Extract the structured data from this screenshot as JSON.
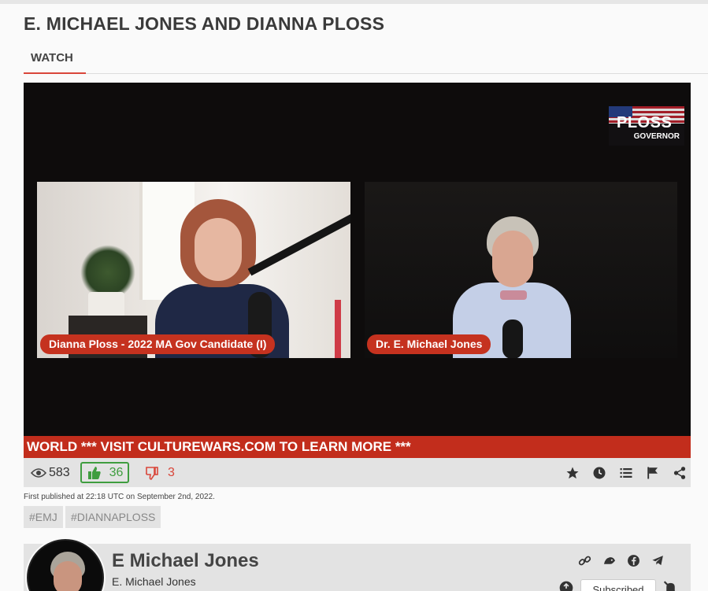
{
  "page": {
    "title": "E. MICHAEL JONES AND DIANNA PLOSS",
    "tabs": [
      {
        "label": "WATCH",
        "active": true
      }
    ]
  },
  "video": {
    "logo_text": "PLOSS",
    "logo_subtext": "GOVERNOR",
    "lower_third_left": "Dianna Ploss - 2022 MA Gov Candidate (I)",
    "lower_third_right": "Dr. E. Michael Jones",
    "ticker_text": "WORLD *** VISIT CULTUREWARS.COM TO LEARN MORE ***"
  },
  "stats": {
    "views": "583",
    "likes": "36",
    "dislikes": "3",
    "actions": [
      "star-icon",
      "clock-icon",
      "list-icon",
      "flag-icon",
      "share-icon"
    ]
  },
  "published": "First published at 22:18 UTC on September 2nd, 2022.",
  "hashtags": [
    "#EMJ",
    "#DIANNAPLOSS"
  ],
  "channel": {
    "name": "E Michael Jones",
    "subtitle": "E. Michael Jones",
    "links": [
      "link-icon",
      "rumble-icon",
      "facebook-icon",
      "telegram-icon"
    ],
    "subscribe_label": "Subscribed"
  },
  "colors": {
    "accent": "#d9463a",
    "like_green": "#3f9d3f",
    "ticker_red": "#c22d1c"
  }
}
